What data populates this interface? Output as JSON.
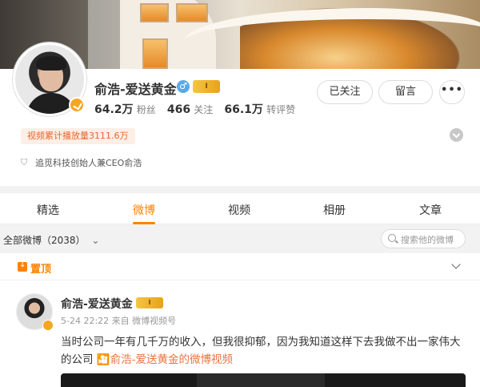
{
  "profile": {
    "name": "俞浩-爱送黄金",
    "gender_symbol": "♂",
    "level_badge": "Ⅰ",
    "stats": [
      {
        "value": "64.2万",
        "label": "粉丝"
      },
      {
        "value": "466",
        "label": "关注"
      },
      {
        "value": "66.1万",
        "label": "转评赞"
      }
    ],
    "buttons": {
      "follow": "已关注",
      "message": "留言",
      "more": "•••"
    },
    "plays_badge": "视频累计播放量3111.6万",
    "bio": "追觅科技创始人兼CEO俞浩"
  },
  "tabs": [
    "精选",
    "微博",
    "视频",
    "相册",
    "文章"
  ],
  "active_tab": "微博",
  "filter": {
    "label": "全部微博（2038）",
    "chevron": "⌄"
  },
  "search": {
    "placeholder": "搜索他的微博"
  },
  "pinned": {
    "label": "置顶",
    "author": "俞浩-爱送黄金",
    "meta": "5-24 22:22 来自 微博视频号",
    "text": "当时公司一年有几千万的收入，但我很抑郁，因为我知道这样下去我做不出一家伟大的公司",
    "link": "🎦俞浩-爱送黄金的微博视频"
  },
  "colors": {
    "accent": "#ff8200",
    "link": "#eb7340",
    "badge_gold": "#f5a623",
    "gender_blue": "#5aa9e6"
  }
}
